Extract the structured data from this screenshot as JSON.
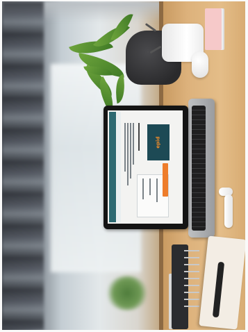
{
  "scene": {
    "kind": "photo",
    "colors": {
      "desk": "#ddb27c",
      "laptop_screen_accent": "#2d6971",
      "screen_button": "#ee7d2b",
      "plant": "#4f8a30"
    }
  },
  "screen": {
    "logo_text": "epid"
  }
}
